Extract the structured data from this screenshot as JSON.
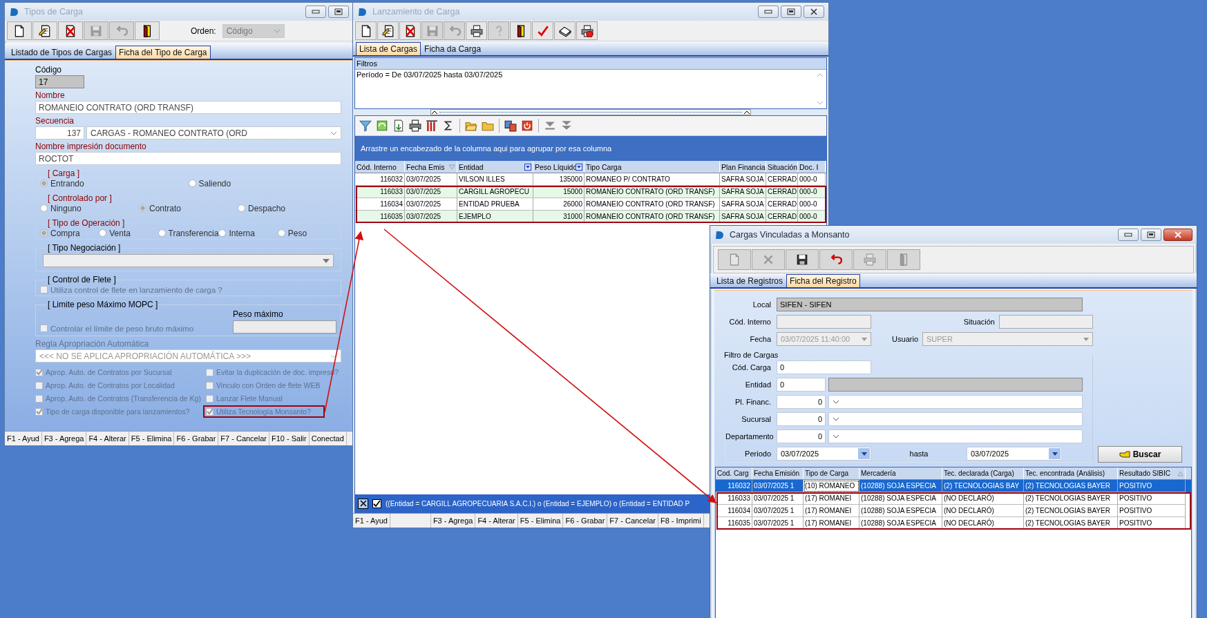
{
  "tipos_window": {
    "title": "Tipos de Carga",
    "active": false,
    "toolbar": [
      {
        "kind": "new",
        "disabled": false
      },
      {
        "kind": "edit",
        "disabled": false
      },
      {
        "kind": "delete",
        "disabled": false
      },
      {
        "kind": "save",
        "disabled": true
      },
      {
        "kind": "undo",
        "disabled": true
      },
      {
        "kind": "exit",
        "disabled": false
      }
    ],
    "order": {
      "label": "Orden:",
      "value": "Código"
    },
    "tabs": [
      {
        "label": "Listado de Tipos de Cargas",
        "selected": false
      },
      {
        "label": "Ficha del Tipo de Carga",
        "selected": true
      }
    ],
    "codigo": {
      "label": "Código",
      "required": false,
      "value": "17"
    },
    "nombre": {
      "label": "Nombre",
      "required": true,
      "value": "ROMANEIO CONTRATO (ORD TRANSF)"
    },
    "secuencia": {
      "label": "Secuencia",
      "required": true,
      "number": "137",
      "value": "CARGAS - ROMANEO CONTRATO (ORD"
    },
    "nombre_impresion": {
      "label": "Nombre impresión documento",
      "required": true,
      "value": "ROCTOT"
    },
    "radio_groups": [
      {
        "title": "[ Carga ]",
        "required": true,
        "options": [
          {
            "label": "Entrando",
            "selected": true
          },
          {
            "label": "Saliendo",
            "selected": false
          }
        ]
      },
      {
        "title": "[ Controlado por ]",
        "required": true,
        "options": [
          {
            "label": "Ninguno",
            "selected": false
          },
          {
            "label": "Contrato",
            "selected": true
          },
          {
            "label": "Despacho",
            "selected": false
          }
        ]
      },
      {
        "title": "[ Tipo de Operación ]",
        "required": true,
        "options": [
          {
            "label": "Compra",
            "selected": true
          },
          {
            "label": "Venta",
            "selected": false
          },
          {
            "label": "Transferencia",
            "selected": false
          },
          {
            "label": "Interna",
            "selected": false
          },
          {
            "label": "Peso",
            "selected": false
          }
        ]
      }
    ],
    "tipo_negociacion": {
      "title": "[ Tipo Negociación ]",
      "required": false
    },
    "control_flete": {
      "title": "[ Control de Flete ]",
      "required": false,
      "checkbox": {
        "label": "Utiliza control de flete en lanzamiento de carga ?",
        "checked": false,
        "disabled": true
      }
    },
    "limite_peso": {
      "title": "[ Limite peso Máximo MOPC ]",
      "required": false,
      "checkbox": {
        "label": "Controlar el límite de peso bruto máximo",
        "checked": false,
        "disabled": true
      },
      "peso_label": "Peso máximo"
    },
    "regla": {
      "label": "Regla Apropriación Automática",
      "value": "<<< NO SE APLICA APROPRIACIÓN AUTOMÁTICA >>>"
    },
    "options": [
      {
        "label": "Aprop. Auto. de Contratos por Sucursal",
        "checked": true,
        "disabled": true,
        "highlighted": false
      },
      {
        "label": "Evitar la duplicación de doc. impreso?",
        "checked": false,
        "disabled": true,
        "highlighted": false
      },
      {
        "label": "Aprop. Auto. de Contratos por Localidad",
        "checked": false,
        "disabled": true,
        "highlighted": false
      },
      {
        "label": "Vinculo con Orden de flete WEB",
        "checked": false,
        "disabled": true,
        "highlighted": false
      },
      {
        "label": "Aprop. Auto. de Contratos (Transferencia de Kg)",
        "checked": false,
        "disabled": true,
        "highlighted": false
      },
      {
        "label": "Lanzar Flete Manual",
        "checked": false,
        "disabled": true,
        "highlighted": false
      },
      {
        "label": "Tipo de carga disponible para lanzamientos?",
        "checked": true,
        "disabled": true,
        "highlighted": false
      },
      {
        "label": "Utiliza Tecnología Monsanto?",
        "checked": true,
        "disabled": true,
        "highlighted": true
      }
    ],
    "status_bar": [
      "F1 - Ayud",
      "F3 - Agrega",
      "F4 - Alterar",
      "F5 - Elimina",
      "F6 - Grabar",
      "F7 - Cancelar",
      "F10 - Salir",
      "Conectad"
    ]
  },
  "lanzamiento_window": {
    "title": "Lanzamiento de Carga",
    "active": false,
    "toolbar": [
      {
        "kind": "new",
        "disabled": false
      },
      {
        "kind": "edit",
        "disabled": false
      },
      {
        "kind": "delete",
        "disabled": false
      },
      {
        "kind": "save",
        "disabled": true
      },
      {
        "kind": "undo",
        "disabled": true
      },
      {
        "kind": "print",
        "disabled": false
      },
      {
        "kind": "help",
        "disabled": true
      },
      {
        "kind": "exit",
        "disabled": false
      },
      {
        "kind": "check",
        "disabled": false
      },
      {
        "kind": "book",
        "disabled": false
      },
      {
        "kind": "print-cancel",
        "disabled": false
      }
    ],
    "tabs": [
      {
        "label": "Lista de Cargas",
        "selected": true
      },
      {
        "label": "Ficha da Carga",
        "selected": false
      }
    ],
    "filters": {
      "label": "Filtros",
      "text": "Período = De 03/07/2025 hasta 03/07/2025"
    },
    "grid_toolbar": [
      {
        "kind": "filter"
      },
      {
        "kind": "refresh"
      },
      {
        "kind": "export"
      },
      {
        "kind": "print"
      },
      {
        "kind": "columns"
      },
      {
        "kind": "sum"
      },
      {
        "kind": "separator"
      },
      {
        "kind": "open-folder"
      },
      {
        "kind": "folder"
      },
      {
        "kind": "separator"
      },
      {
        "kind": "windows"
      },
      {
        "kind": "power"
      },
      {
        "kind": "separator"
      },
      {
        "kind": "down"
      },
      {
        "kind": "down-double"
      }
    ],
    "group_hint": "Arrastre un encabezado de la columna aqui para agrupar por esa columna",
    "table": {
      "columns": [
        {
          "label": "Cód. Interno",
          "filtered": false,
          "sorted": false
        },
        {
          "label": "Fecha Emis",
          "filtered": false,
          "sorted": true
        },
        {
          "label": "Entidad",
          "filtered": true,
          "sorted": false
        },
        {
          "label": "Peso Líquido",
          "filtered": true,
          "sorted": false
        },
        {
          "label": "Tipo Carga",
          "filtered": false,
          "sorted": false
        },
        {
          "label": "Plan Financia",
          "filtered": false,
          "sorted": false
        },
        {
          "label": "Situación",
          "filtered": false,
          "sorted": false
        },
        {
          "label": "Doc. I",
          "filtered": false,
          "sorted": false
        }
      ],
      "rows": [
        {
          "highlighted": false,
          "cells": [
            "116032",
            "03/07/2025",
            "VILSON ILLES",
            "135000",
            "ROMANEO P/ CONTRATO",
            "SAFRA SOJA",
            "CERRAD",
            "000-0"
          ]
        },
        {
          "highlighted": true,
          "cells": [
            "116033",
            "03/07/2025",
            "CARGILL AGROPECU",
            "15000",
            "ROMANEIO CONTRATO (ORD TRANSF)",
            "SAFRA SOJA",
            "CERRAD",
            "000-0"
          ]
        },
        {
          "highlighted": true,
          "cells": [
            "116034",
            "03/07/2025",
            "ENTIDAD PRUEBA",
            "26000",
            "ROMANEIO CONTRATO (ORD TRANSF)",
            "SAFRA SOJA",
            "CERRAD",
            "000-0"
          ]
        },
        {
          "highlighted": true,
          "cells": [
            "116035",
            "03/07/2025",
            "EJEMPLO",
            "31000",
            "ROMANEIO CONTRATO (ORD TRANSF)",
            "SAFRA SOJA",
            "CERRAD",
            "000-0"
          ]
        }
      ]
    },
    "filter_bar": {
      "enabled": true,
      "text": "((Entidad = CARGILL AGROPECUARIA S.A.C.I.) o (Entidad = EJEMPLO) o (Entidad = ENTIDAD P"
    },
    "status_bar": [
      "F1 - Ayud",
      "F3 - Agrega",
      "F4 - Alterar",
      "F5 - Elimina",
      "F6 - Grabar",
      "F7 - Cancelar",
      "F8 - Imprimi"
    ]
  },
  "vinculadas_window": {
    "title": "Cargas Vinculadas a Monsanto",
    "active": true,
    "toolbar": [
      {
        "kind": "new",
        "disabled": true
      },
      {
        "kind": "cross",
        "disabled": true
      },
      {
        "kind": "save",
        "disabled": false
      },
      {
        "kind": "undo",
        "disabled": false
      },
      {
        "kind": "print",
        "disabled": true
      },
      {
        "kind": "exit",
        "disabled": true
      }
    ],
    "tabs": [
      {
        "label": "Lista de Registros",
        "selected": false
      },
      {
        "label": "Ficha del Registro",
        "selected": true
      }
    ],
    "local": {
      "label": "Local",
      "value": "SIFEN - SIFEN"
    },
    "cod_interno": {
      "label": "Cód. Interno"
    },
    "situacion": {
      "label": "Situación"
    },
    "fecha": {
      "label": "Fecha",
      "value": "03/07/2025 11:40:00"
    },
    "usuario": {
      "label": "Usuario",
      "value": "SUPER"
    },
    "filter_title": "Filtro de Cargas",
    "cod_carga": {
      "label": "Cód. Carga",
      "value": "0"
    },
    "entidad": {
      "label": "Entidad",
      "value": "0"
    },
    "lookups": [
      {
        "label": "Pl. Financ.",
        "value": "0"
      },
      {
        "label": "Sucursal",
        "value": "0"
      },
      {
        "label": "Departamento",
        "value": "0"
      }
    ],
    "periodo": {
      "label": "Periodo",
      "from": "03/07/2025",
      "to_label": "hasta",
      "to": "03/07/2025"
    },
    "search_button": "Buscar",
    "table": {
      "columns": [
        {
          "label": "Cod. Carg",
          "sorted": false
        },
        {
          "label": "Fecha Emisión",
          "sorted": false
        },
        {
          "label": "Tipo de Carga",
          "sorted": false
        },
        {
          "label": "Mercadería",
          "sorted": false
        },
        {
          "label": "Tec. declarada (Carga)",
          "sorted": false
        },
        {
          "label": "Tec. encontrada (Análisis)",
          "sorted": false
        },
        {
          "label": "Resultado SIBIC",
          "sorted": true
        }
      ],
      "rows": [
        {
          "selected": true,
          "highlighted": false,
          "cells": [
            {
              "text": "116032",
              "focused": false
            },
            {
              "text": "03/07/2025 1",
              "focused": false
            },
            {
              "text": "(10) ROMANEO",
              "focused": true
            },
            {
              "text": "(10288) SOJA ESPECIA",
              "focused": false
            },
            {
              "text": "(2) TECNOLOGIAS BAY",
              "focused": false
            },
            {
              "text": "(2) TECNOLOGIAS BAYER",
              "focused": false
            },
            {
              "text": "POSITIVO",
              "focused": false
            }
          ]
        },
        {
          "selected": false,
          "highlighted": true,
          "cells": [
            {
              "text": "116033",
              "focused": false
            },
            {
              "text": "03/07/2025 1",
              "focused": false
            },
            {
              "text": "(17) ROMANEI",
              "focused": false
            },
            {
              "text": "(10288) SOJA ESPECIA",
              "focused": false
            },
            {
              "text": "(NO DECLARÓ)",
              "focused": false
            },
            {
              "text": "(2) TECNOLOGIAS BAYER",
              "focused": false
            },
            {
              "text": "POSITIVO",
              "focused": false
            }
          ]
        },
        {
          "selected": false,
          "highlighted": true,
          "cells": [
            {
              "text": "116034",
              "focused": false
            },
            {
              "text": "03/07/2025 1",
              "focused": false
            },
            {
              "text": "(17) ROMANEI",
              "focused": false
            },
            {
              "text": "(10288) SOJA ESPECIA",
              "focused": false
            },
            {
              "text": "(NO DECLARÓ)",
              "focused": false
            },
            {
              "text": "(2) TECNOLOGIAS BAYER",
              "focused": false
            },
            {
              "text": "POSITIVO",
              "focused": false
            }
          ]
        },
        {
          "selected": false,
          "highlighted": true,
          "cells": [
            {
              "text": "116035",
              "focused": false
            },
            {
              "text": "03/07/2025 1",
              "focused": false
            },
            {
              "text": "(17) ROMANEI",
              "focused": false
            },
            {
              "text": "(10288) SOJA ESPECIA",
              "focused": false
            },
            {
              "text": "(NO DECLARÓ)",
              "focused": false
            },
            {
              "text": "(2) TECNOLOGIAS BAYER",
              "focused": false
            },
            {
              "text": "POSITIVO",
              "focused": false
            }
          ]
        }
      ]
    }
  }
}
